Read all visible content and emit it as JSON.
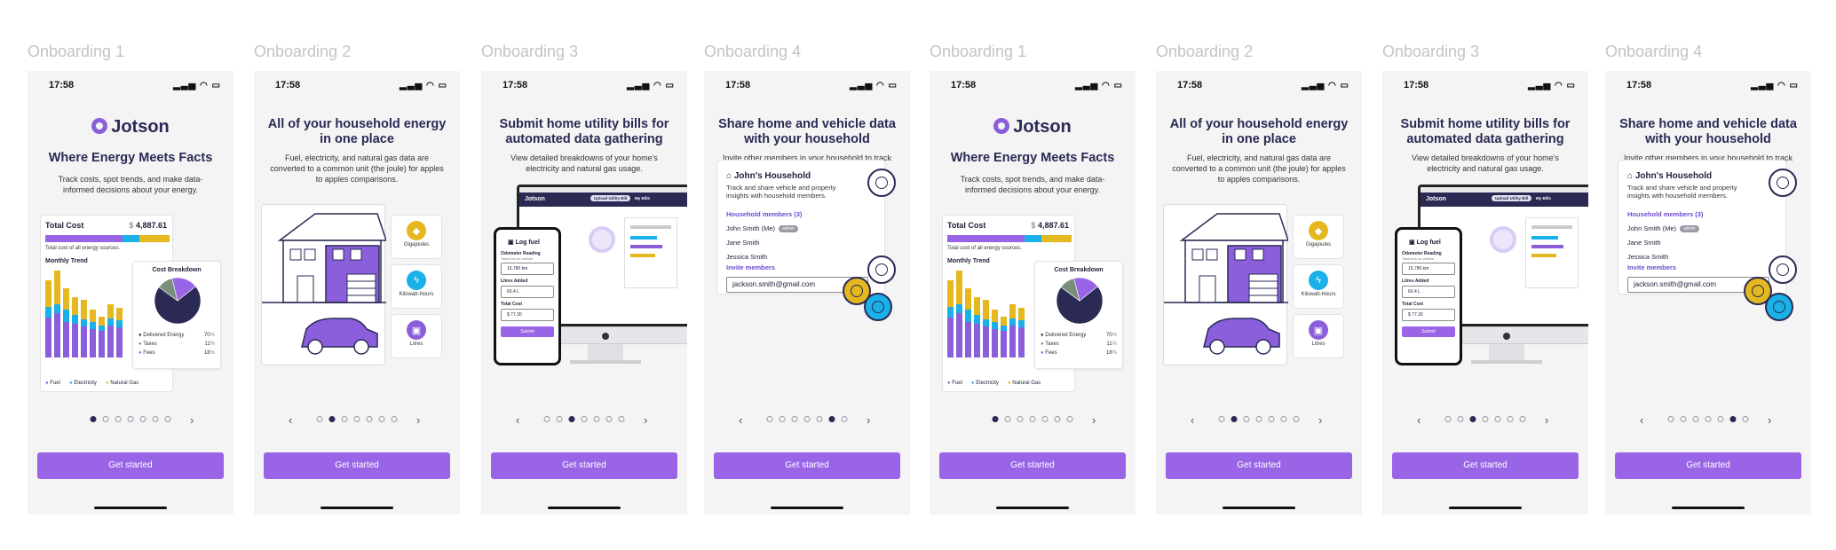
{
  "status": {
    "time": "17:58",
    "signal_icon": "signal-icon",
    "wifi_icon": "wifi-icon",
    "battery_icon": "battery-icon"
  },
  "labels": [
    "Onboarding 1",
    "Onboarding 2",
    "Onboarding 3",
    "Onboarding 4",
    "Onboarding 1",
    "Onboarding 2",
    "Onboarding 3",
    "Onboarding 4"
  ],
  "cta": "Get started",
  "nav": {
    "prev_icon": "chevron-left-icon",
    "next_icon": "chevron-right-icon",
    "total_dots": 7
  },
  "colors": {
    "accent": "#9965e6",
    "navy": "#2a2a55",
    "fuel": "#8b5fdc",
    "electricity": "#1ab0e8",
    "gas": "#e4b81e",
    "background": "#f4f4f5"
  },
  "s1": {
    "brand": "Jotson",
    "title": "Where Energy Meets Facts",
    "desc": "Track costs, spot trends, and make data-informed decisions about your energy.",
    "total_cost_label": "Total Cost",
    "currency": "$",
    "total_cost_value": "4,887.61",
    "total_cost_caption": "Total cost of all energy sources.",
    "trend_label": "Monthly Trend",
    "breakdown_label": "Cost Breakdown",
    "breakdown": [
      {
        "label": "Delivered Energy",
        "pct": "70",
        "unit": "%"
      },
      {
        "label": "Taxes",
        "pct": "11",
        "unit": "%"
      },
      {
        "label": "Fees",
        "pct": "18",
        "unit": "%"
      }
    ],
    "legend": [
      "Fuel",
      "Electricity",
      "Natural Gas"
    ],
    "active_dot": 0
  },
  "s2": {
    "title": "All of your household energy in one place",
    "desc": "Fuel, electricity, and natural gas data are converted to a common unit (the joule) for apples to apples comparisons.",
    "chips": [
      {
        "label": "Gigajoules",
        "icon": "flame-icon"
      },
      {
        "label": "Kilowatt-Hours",
        "icon": "lightning-icon"
      },
      {
        "label": "Litres",
        "icon": "fuel-can-icon"
      }
    ],
    "active_dot": 1
  },
  "s3": {
    "title": "Submit home utility bills for automated data gathering",
    "desc": "View detailed breakdowns of your home's electricity and natural gas usage.",
    "monitor_brand": "Jotson",
    "monitor_btn": "Upload Utility Bill",
    "monitor_nav": "My Bills",
    "form_title": "Log fuel",
    "odometer_label": "Odometer Reading",
    "odometer_hint": "Total kms on vehicle",
    "odometer_value": "15,780 km",
    "litres_label": "Litres Added",
    "litres_value": "60.4 L",
    "total_label": "Total Cost",
    "total_value": "$ 77.30",
    "submit": "Submit",
    "active_dot": 2
  },
  "s4": {
    "title": "Share home and vehicle data with your household",
    "desc": "Invite other members in your household to track and share energy analytics.",
    "household": "John's Household",
    "household_desc": "Track and share vehicle and property insights with household members.",
    "members_label": "Household members (3)",
    "members": [
      "John Smith (Me)",
      "Jane Smith",
      "Jessica Smith"
    ],
    "admin_badge": "admin",
    "invite_label": "Invite members",
    "invite_email": "jackson.smith@gmail.com",
    "active_dot": 5
  },
  "trend": [
    {
      "fuel": 45,
      "elec": 12,
      "gas": 30
    },
    {
      "fuel": 50,
      "elec": 10,
      "gas": 38
    },
    {
      "fuel": 40,
      "elec": 14,
      "gas": 24
    },
    {
      "fuel": 38,
      "elec": 10,
      "gas": 20
    },
    {
      "fuel": 35,
      "elec": 8,
      "gas": 22
    },
    {
      "fuel": 32,
      "elec": 8,
      "gas": 14
    },
    {
      "fuel": 30,
      "elec": 6,
      "gas": 10
    },
    {
      "fuel": 36,
      "elec": 8,
      "gas": 16
    },
    {
      "fuel": 34,
      "elec": 8,
      "gas": 14
    }
  ],
  "pie": [
    70,
    11,
    18
  ]
}
